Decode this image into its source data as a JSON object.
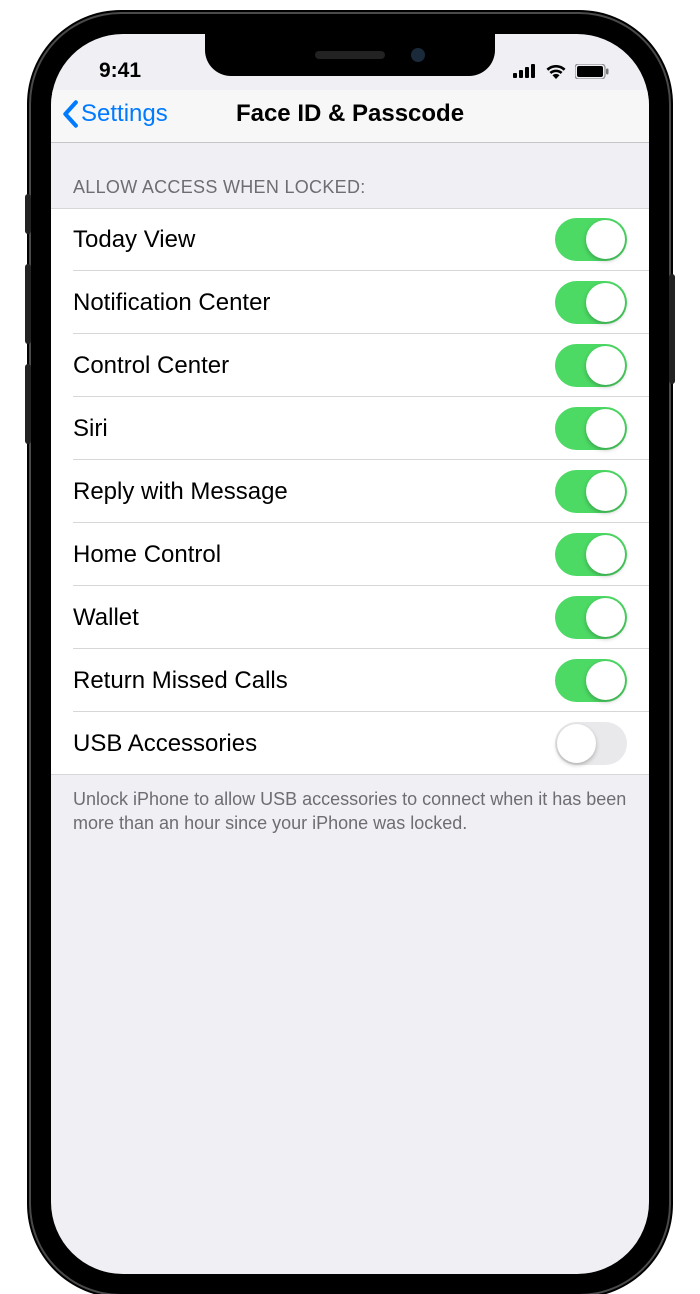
{
  "status": {
    "time": "9:41"
  },
  "nav": {
    "back": "Settings",
    "title": "Face ID & Passcode"
  },
  "section": {
    "header": "ALLOW ACCESS WHEN LOCKED:",
    "footer": "Unlock iPhone to allow USB accessories to connect when it has been more than an hour since your iPhone was locked."
  },
  "items": [
    {
      "label": "Today View",
      "on": true
    },
    {
      "label": "Notification Center",
      "on": true
    },
    {
      "label": "Control Center",
      "on": true
    },
    {
      "label": "Siri",
      "on": true
    },
    {
      "label": "Reply with Message",
      "on": true
    },
    {
      "label": "Home Control",
      "on": true
    },
    {
      "label": "Wallet",
      "on": true
    },
    {
      "label": "Return Missed Calls",
      "on": true
    },
    {
      "label": "USB Accessories",
      "on": false
    }
  ]
}
